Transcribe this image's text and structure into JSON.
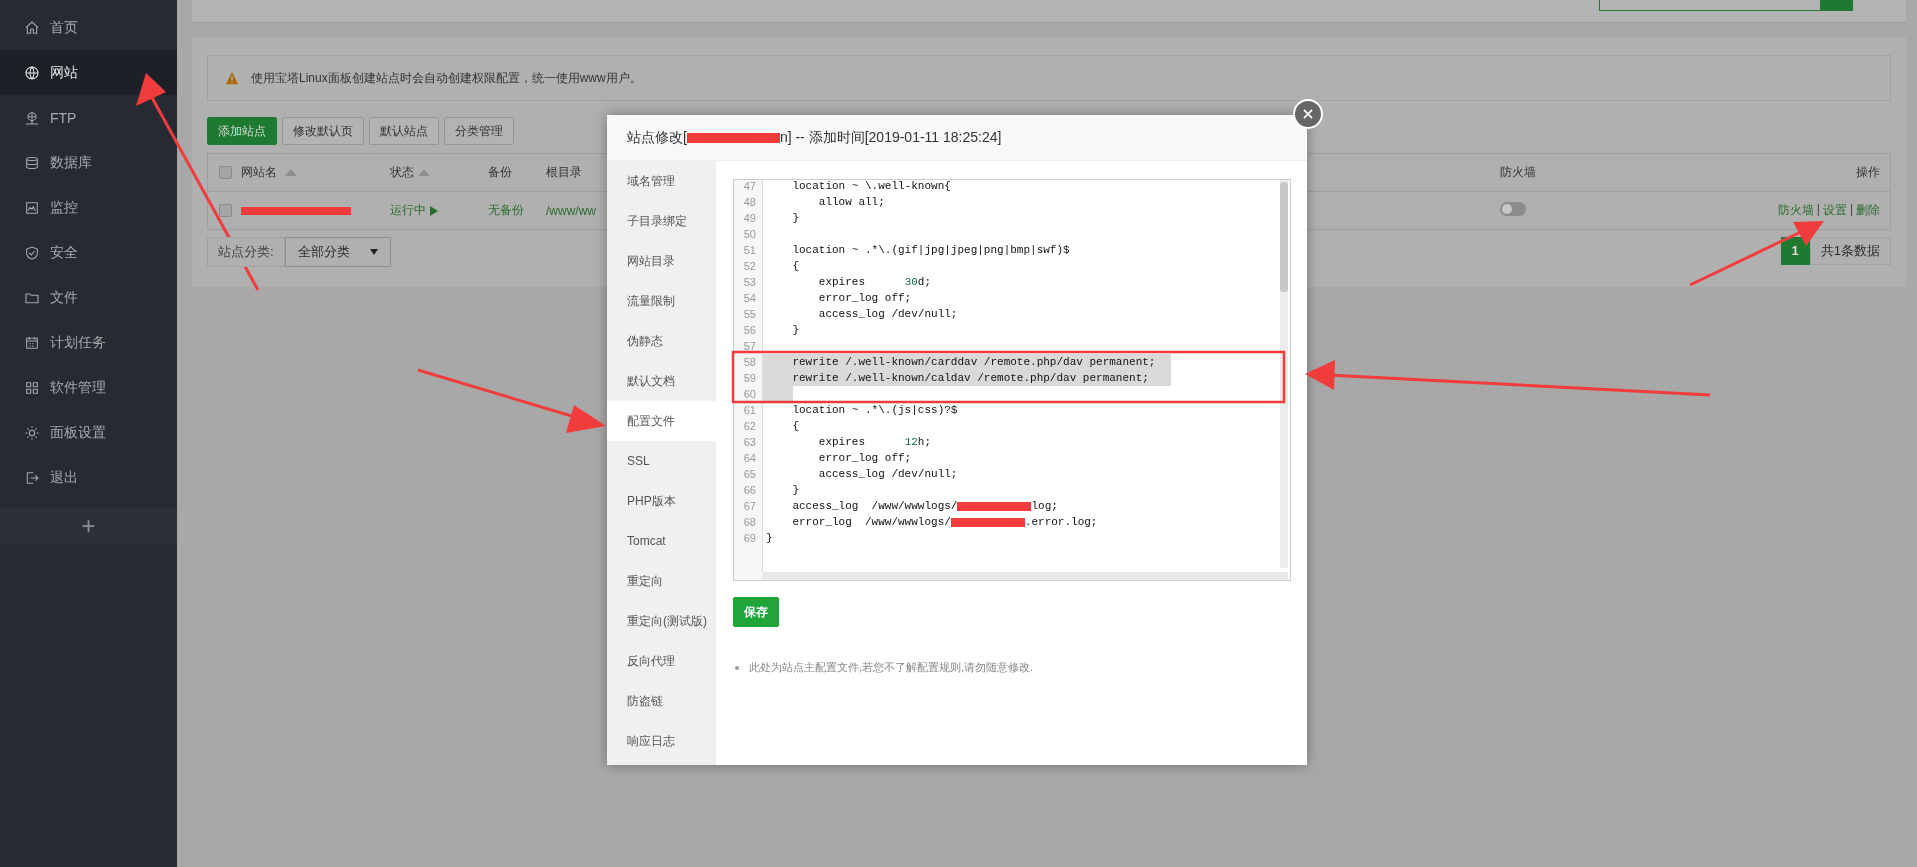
{
  "sidebar": {
    "items": [
      {
        "label": "首页",
        "selected": false
      },
      {
        "label": "网站",
        "selected": true
      },
      {
        "label": "FTP",
        "selected": false
      },
      {
        "label": "数据库",
        "selected": false
      },
      {
        "label": "监控",
        "selected": false
      },
      {
        "label": "安全",
        "selected": false
      },
      {
        "label": "文件",
        "selected": false
      },
      {
        "label": "计划任务",
        "selected": false
      },
      {
        "label": "软件管理",
        "selected": false
      },
      {
        "label": "面板设置",
        "selected": false
      },
      {
        "label": "退出",
        "selected": false
      }
    ],
    "add_label": "+"
  },
  "alert": "使用宝塔Linux面板创建站点时会自动创建权限配置，统一使用www用户。",
  "toolbar": [
    {
      "label": "添加站点",
      "primary": true
    },
    {
      "label": "修改默认页",
      "primary": false
    },
    {
      "label": "默认站点",
      "primary": false
    },
    {
      "label": "分类管理",
      "primary": false
    }
  ],
  "table": {
    "header_checked": false,
    "columns": [
      {
        "label": "网站名",
        "sortable": true
      },
      {
        "label": "状态",
        "sortable": true
      },
      {
        "label": "备份",
        "sortable": false
      },
      {
        "label": "根目录",
        "sortable": false
      },
      {
        "label": "防火墙",
        "sortable": false
      },
      {
        "label": "操作",
        "sortable": false
      }
    ],
    "rows": [
      {
        "checked": false,
        "status": "运行中",
        "backup": "无备份",
        "root": "/www/ww",
        "firewall_on": false,
        "actions": [
          {
            "label": "防火墙"
          },
          {
            "separator": "|",
            "label": "设置"
          },
          {
            "separator": "|",
            "label": "删除"
          }
        ]
      }
    ]
  },
  "filter": {
    "label": "站点分类:",
    "value": "全部分类"
  },
  "pagination": {
    "page": "1",
    "total": "共1条数据"
  },
  "modal": {
    "title_prefix": "站点修改[",
    "title_suffix": "n] -- 添加时间[2019-01-11 18:25:24]",
    "menu": [
      {
        "label": "域名管理",
        "selected": false
      },
      {
        "label": "子目录绑定",
        "selected": false
      },
      {
        "label": "网站目录",
        "selected": false
      },
      {
        "label": "流量限制",
        "selected": false
      },
      {
        "label": "伪静态",
        "selected": false
      },
      {
        "label": "默认文档",
        "selected": false
      },
      {
        "label": "配置文件",
        "selected": true
      },
      {
        "label": "SSL",
        "selected": false
      },
      {
        "label": "PHP版本",
        "selected": false
      },
      {
        "label": "Tomcat",
        "selected": false
      },
      {
        "label": "重定向",
        "selected": false
      },
      {
        "label": "重定向(测试版)",
        "selected": false
      },
      {
        "label": "反向代理",
        "selected": false
      },
      {
        "label": "防盗链",
        "selected": false
      },
      {
        "label": "响应日志",
        "selected": false
      }
    ],
    "code": [
      {
        "num": "47",
        "highlighted": false,
        "parts": [
          {
            "t": "    location ~ \\.well-known{"
          }
        ]
      },
      {
        "num": "48",
        "highlighted": false,
        "parts": [
          {
            "t": "        allow all;"
          }
        ]
      },
      {
        "num": "49",
        "highlighted": false,
        "parts": [
          {
            "t": "    }"
          }
        ]
      },
      {
        "num": "50"
      },
      {
        "num": "51",
        "highlighted": false,
        "parts": [
          {
            "t": "    location ~ .*\\.(gif|jpg|jpeg|png|bmp|swf)$"
          }
        ]
      },
      {
        "num": "52",
        "highlighted": false,
        "parts": [
          {
            "t": "    {"
          }
        ]
      },
      {
        "num": "53",
        "highlighted": false,
        "parts": [
          {
            "t": "        expires      "
          },
          {
            "t": "30",
            "kind": "number"
          },
          {
            "t": "d;"
          }
        ]
      },
      {
        "num": "54",
        "highlighted": false,
        "parts": [
          {
            "t": "        error_log off;"
          }
        ]
      },
      {
        "num": "55",
        "highlighted": false,
        "parts": [
          {
            "t": "        access_log /dev/null;"
          }
        ]
      },
      {
        "num": "56",
        "highlighted": false,
        "parts": [
          {
            "t": "    }"
          }
        ]
      },
      {
        "num": "57"
      },
      {
        "num": "58",
        "highlighted": true,
        "parts": [
          {
            "t": "    rewrite /.well-known/carddav /remote.php/dav permanent;"
          }
        ]
      },
      {
        "num": "59",
        "highlighted": true,
        "parts": [
          {
            "t": "    rewrite /.well-known/caldav /remote.php/dav permanent;"
          }
        ]
      },
      {
        "num": "60",
        "highlighted": true
      },
      {
        "num": "61",
        "highlighted": false,
        "parts": [
          {
            "t": "    location ~ .*\\.(js|css)?$"
          }
        ]
      },
      {
        "num": "62",
        "highlighted": false,
        "parts": [
          {
            "t": "    {"
          }
        ]
      },
      {
        "num": "63",
        "highlighted": false,
        "parts": [
          {
            "t": "        expires      "
          },
          {
            "t": "12",
            "kind": "number"
          },
          {
            "t": "h;"
          }
        ]
      },
      {
        "num": "64",
        "highlighted": false,
        "parts": [
          {
            "t": "        error_log off;"
          }
        ]
      },
      {
        "num": "65",
        "highlighted": false,
        "parts": [
          {
            "t": "        access_log /dev/null;"
          }
        ]
      },
      {
        "num": "66",
        "highlighted": false,
        "parts": [
          {
            "t": "    }"
          }
        ]
      },
      {
        "num": "67",
        "highlighted": false,
        "parts": [
          {
            "t": "    access_log  /www/wwwlogs/"
          },
          {
            "kind": "redacted"
          },
          {
            "t": "log;"
          }
        ]
      },
      {
        "num": "68",
        "highlighted": false,
        "parts": [
          {
            "t": "    error_log  /www/wwwlogs/"
          },
          {
            "kind": "redacted"
          },
          {
            "t": ".error.log;"
          }
        ]
      },
      {
        "num": "69",
        "highlighted": false,
        "parts": [
          {
            "t": "}"
          }
        ]
      }
    ],
    "save": "保存",
    "note": "此处为站点主配置文件,若您不了解配置规则,请勿随意修改."
  }
}
